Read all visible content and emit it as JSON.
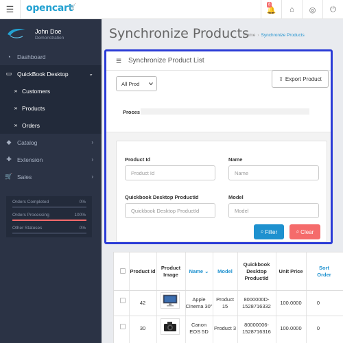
{
  "header": {
    "logo_text": "opencart",
    "notification_count": "8",
    "icons": [
      "menu-icon",
      "bell-icon",
      "home-icon",
      "lifebuoy-icon",
      "power-icon"
    ]
  },
  "sidebar": {
    "user_name": "John Doe",
    "user_role": "Demonstration",
    "items": [
      {
        "label": "Dashboard",
        "icon": "dashboard-icon"
      },
      {
        "label": "QuickBook Desktop",
        "icon": "desktop-icon"
      },
      {
        "label": "Customers",
        "icon": "double-chevron-icon"
      },
      {
        "label": "Products",
        "icon": "double-chevron-icon"
      },
      {
        "label": "Orders",
        "icon": "double-chevron-icon"
      },
      {
        "label": "Catalog",
        "icon": "tag-icon"
      },
      {
        "label": "Extension",
        "icon": "puzzle-icon"
      },
      {
        "label": "Sales",
        "icon": "cart-icon"
      }
    ],
    "stats": [
      {
        "label": "Orders Completed",
        "value": "0%",
        "fraction": 0,
        "color": "#1e91cf"
      },
      {
        "label": "Orders Processing",
        "value": "100%",
        "fraction": 1.0,
        "color": "#f56b6b"
      },
      {
        "label": "Other Statuses",
        "value": "0%",
        "fraction": 0,
        "color": "#8fbb6c"
      }
    ]
  },
  "page": {
    "title": "Synchronize Products",
    "breadcrumb": [
      "Home",
      "Synchronize Products"
    ]
  },
  "panel": {
    "title": "Synchronize Product List",
    "select_value": "All Prod",
    "export_label": "Export Product",
    "process_label": "Proces",
    "filters": {
      "product_id_label": "Product Id",
      "product_id_placeholder": "Product Id",
      "name_label": "Name",
      "name_placeholder": "Name",
      "qb_id_label": "Quickbook Desktop ProductId",
      "qb_id_placeholder": "Quickbook Desktop ProductId",
      "model_label": "Model",
      "model_placeholder": "Model",
      "filter_label": "Filter",
      "clear_label": "Clear"
    }
  },
  "table": {
    "headers": [
      "Product Id",
      "Product Image",
      "Name",
      "Model",
      "Quickbook Desktop ProductId",
      "Unit Price",
      "Sort Order"
    ],
    "rows": [
      {
        "id": "42",
        "image": "monitor-thumbnail",
        "name": "Apple Cinema 30\"",
        "model": "Product 15",
        "qb_id": "8000000D-1528716332",
        "price": "100.0000",
        "sort": "0"
      },
      {
        "id": "30",
        "image": "camera-thumbnail",
        "name": "Canon EOS 5D",
        "model": "Product 3",
        "qb_id": "80000006-1528716316",
        "price": "100.0000",
        "sort": "0"
      }
    ]
  },
  "colors": {
    "brand": "#23a1d1",
    "sidebar_bg": "#2b3345",
    "primary": "#1e91cf",
    "danger": "#f56b6b",
    "highlight_border": "#2a3bd6"
  }
}
